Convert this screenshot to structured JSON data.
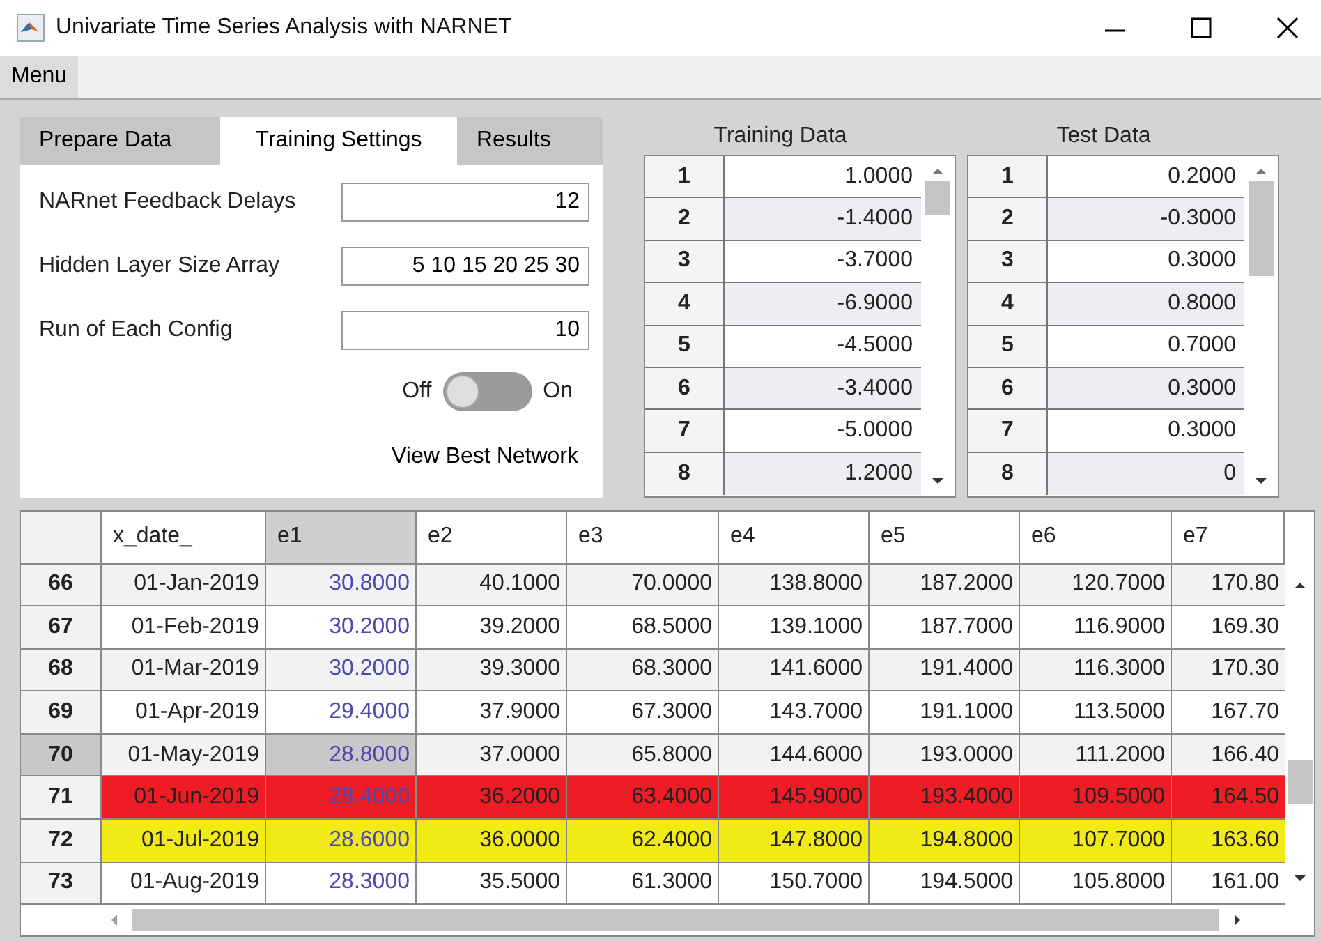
{
  "window": {
    "title": "Univariate Time Series Analysis with NARNET"
  },
  "menu": [
    "Menu"
  ],
  "tabs": [
    {
      "label": "Prepare Data",
      "selected": false
    },
    {
      "label": "Training Settings",
      "selected": true
    },
    {
      "label": "Results",
      "selected": false
    }
  ],
  "settings": [
    {
      "label": "NARnet Feedback Delays",
      "value": "12"
    },
    {
      "label": "Hidden Layer Size Array",
      "value": "5 10 15 20 25 30"
    },
    {
      "label": "Run of Each Config",
      "value": "10"
    }
  ],
  "switch": {
    "off_label": "Off",
    "on_label": "On",
    "on": false
  },
  "view_button": "View Best Network",
  "training_data": {
    "title": "Training Data",
    "rows": [
      [
        "1",
        "1.0000"
      ],
      [
        "2",
        "-1.4000"
      ],
      [
        "3",
        "-3.7000"
      ],
      [
        "4",
        "-6.9000"
      ],
      [
        "5",
        "-4.5000"
      ],
      [
        "6",
        "-3.4000"
      ],
      [
        "7",
        "-5.0000"
      ],
      [
        "8",
        "1.2000"
      ]
    ]
  },
  "test_data": {
    "title": "Test Data",
    "rows": [
      [
        "1",
        "0.2000"
      ],
      [
        "2",
        "-0.3000"
      ],
      [
        "3",
        "0.3000"
      ],
      [
        "4",
        "0.8000"
      ],
      [
        "5",
        "0.7000"
      ],
      [
        "6",
        "0.3000"
      ],
      [
        "7",
        "0.3000"
      ],
      [
        "8",
        "0"
      ]
    ]
  },
  "table": {
    "columns": [
      {
        "label": "x_date_",
        "selected": false
      },
      {
        "label": "e1",
        "selected": true
      },
      {
        "label": "e2",
        "selected": false
      },
      {
        "label": "e3",
        "selected": false
      },
      {
        "label": "e4",
        "selected": false
      },
      {
        "label": "e5",
        "selected": false
      },
      {
        "label": "e6",
        "selected": false
      },
      {
        "label": "e7",
        "selected": false
      }
    ],
    "rows": [
      {
        "index": "66",
        "selected": false,
        "cells": [
          "01-Jan-2019",
          "30.8000",
          "40.1000",
          "70.0000",
          "138.8000",
          "187.2000",
          "120.7000",
          "170.80"
        ]
      },
      {
        "index": "67",
        "selected": false,
        "cells": [
          "01-Feb-2019",
          "30.2000",
          "39.2000",
          "68.5000",
          "139.1000",
          "187.7000",
          "116.9000",
          "169.30"
        ]
      },
      {
        "index": "68",
        "selected": false,
        "cells": [
          "01-Mar-2019",
          "30.2000",
          "39.3000",
          "68.3000",
          "141.6000",
          "191.4000",
          "116.3000",
          "170.30"
        ]
      },
      {
        "index": "69",
        "selected": false,
        "cells": [
          "01-Apr-2019",
          "29.4000",
          "37.9000",
          "67.3000",
          "143.7000",
          "191.1000",
          "113.5000",
          "167.70"
        ]
      },
      {
        "index": "70",
        "selected": true,
        "cells": [
          "01-May-2019",
          "28.8000",
          "37.0000",
          "65.8000",
          "144.6000",
          "193.0000",
          "111.2000",
          "166.40"
        ]
      },
      {
        "index": "71",
        "selected": false,
        "color": "#ee1c24",
        "cells": [
          "01-Jun-2019",
          "28.4000",
          "36.2000",
          "63.4000",
          "145.9000",
          "193.4000",
          "109.5000",
          "164.50"
        ]
      },
      {
        "index": "72",
        "selected": false,
        "color": "#f2ea14",
        "cells": [
          "01-Jul-2019",
          "28.6000",
          "36.0000",
          "62.4000",
          "147.8000",
          "194.8000",
          "107.7000",
          "163.60"
        ]
      },
      {
        "index": "73",
        "selected": false,
        "cells": [
          "01-Aug-2019",
          "28.3000",
          "35.5000",
          "61.3000",
          "150.7000",
          "194.5000",
          "105.8000",
          "161.00"
        ]
      }
    ]
  }
}
